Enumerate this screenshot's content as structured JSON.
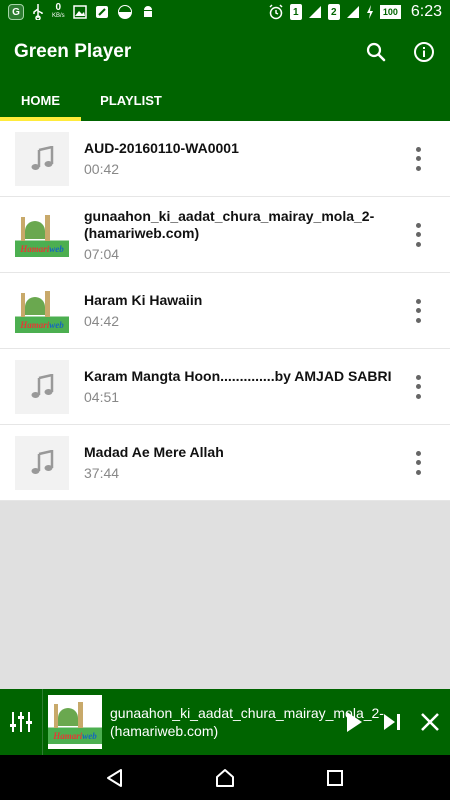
{
  "status_bar": {
    "app_badge": "G",
    "net_speed": "0",
    "net_unit": "KB/s",
    "sim1": "1",
    "sim2": "2",
    "battery": "100",
    "time": "6:23"
  },
  "app": {
    "title": "Green Player",
    "accent_color": "#006400",
    "tab_indicator_color": "#ffeb3b"
  },
  "tabs": [
    {
      "label": "HOME",
      "active": true
    },
    {
      "label": "PLAYLIST",
      "active": false
    }
  ],
  "songs": [
    {
      "title": "AUD-20160110-WA0001",
      "duration": "00:42",
      "thumb": "music-note-icon"
    },
    {
      "title": "gunaahon_ki_aadat_chura_mairay_mola_2-(hamariweb.com)",
      "duration": "07:04",
      "thumb": "hamariweb-thumbnail"
    },
    {
      "title": "Haram Ki Hawaiin",
      "duration": "04:42",
      "thumb": "hamariweb-thumbnail"
    },
    {
      "title": "Karam Mangta Hoon..............by  AMJAD SABRI",
      "duration": "04:51",
      "thumb": "music-note-icon"
    },
    {
      "title": "Madad Ae Mere Allah",
      "duration": "37:44",
      "thumb": "music-note-icon"
    }
  ],
  "now_playing": {
    "title": "gunaahon_ki_aadat_chura_mairay_mola_2-(hamariweb.com)",
    "thumb": "hamariweb-thumbnail"
  },
  "hamariweb_logo": {
    "part1": "Hamari",
    "part2": "web"
  }
}
